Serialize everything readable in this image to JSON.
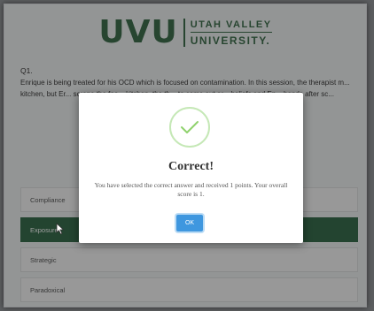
{
  "header": {
    "logo_mark": "UVU",
    "logo_line1": "UTAH VALLEY",
    "logo_line2": "UNIVERSITY."
  },
  "question": {
    "number": "Q1.",
    "text": "Enrique is being treated for his OCD which is focused on contamination. In this session, the therapist m... kitchen, but Er... scrape the foo... kitchen, the th... to come out ar... beliefs and En... hands after sc..."
  },
  "options": [
    {
      "label": "Compliance",
      "selected": false
    },
    {
      "label": "Exposure",
      "selected": true
    },
    {
      "label": "Strategic",
      "selected": false
    },
    {
      "label": "Paradoxical",
      "selected": false
    }
  ],
  "modal": {
    "icon": "check-icon",
    "title": "Correct!",
    "message": "You have selected the correct answer and received 1 points. Your overall score is 1.",
    "ok_label": "OK"
  },
  "colors": {
    "brand_green": "#275d38",
    "selected_green": "#1f5b37",
    "ok_blue": "#3f97df",
    "check_green": "#8fd26d"
  }
}
